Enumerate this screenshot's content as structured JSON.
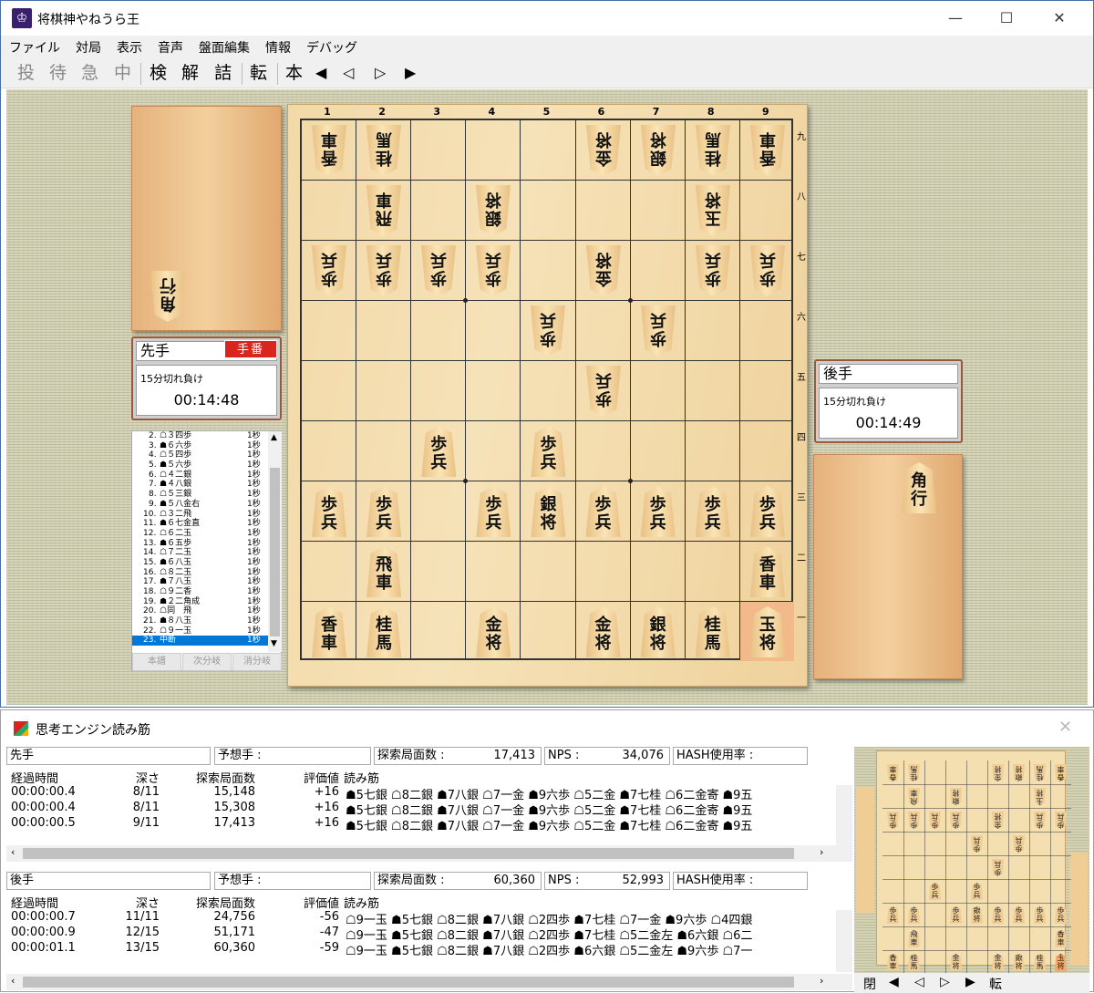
{
  "window": {
    "title": "将棋神やねうら王",
    "minimize": "—",
    "maximize": "☐",
    "close": "✕"
  },
  "menu": [
    "ファイル",
    "対局",
    "表示",
    "音声",
    "盤面編集",
    "情報",
    "デバッグ"
  ],
  "toolbar": {
    "b1": "投",
    "b2": "待",
    "b3": "急",
    "b4": "中",
    "b5": "検",
    "b6": "解",
    "b7": "詰",
    "b8": "転",
    "b9": "本",
    "b10": "◀",
    "b11": "◁",
    "b12": "▷",
    "b13": "▶"
  },
  "sente": {
    "name": "先手",
    "turn_badge": "手番",
    "rule": "15分切れ負け",
    "time": "00:14:48",
    "hand": [
      "角"
    ]
  },
  "gote": {
    "name": "後手",
    "rule": "15分切れ負け",
    "time": "00:14:49",
    "hand": [
      "角行"
    ]
  },
  "kifu": {
    "moves": [
      {
        "n": "2.",
        "m": "☖３四歩",
        "t": "1秒"
      },
      {
        "n": "3.",
        "m": "☗６六歩",
        "t": "1秒"
      },
      {
        "n": "4.",
        "m": "☖５四歩",
        "t": "1秒"
      },
      {
        "n": "5.",
        "m": "☗５六歩",
        "t": "1秒"
      },
      {
        "n": "6.",
        "m": "☖４二銀",
        "t": "1秒"
      },
      {
        "n": "7.",
        "m": "☗４八銀",
        "t": "1秒"
      },
      {
        "n": "8.",
        "m": "☖５三銀",
        "t": "1秒"
      },
      {
        "n": "9.",
        "m": "☗５八金右",
        "t": "1秒"
      },
      {
        "n": "10.",
        "m": "☖３二飛",
        "t": "1秒"
      },
      {
        "n": "11.",
        "m": "☗６七金直",
        "t": "1秒"
      },
      {
        "n": "12.",
        "m": "☖６二玉",
        "t": "1秒"
      },
      {
        "n": "13.",
        "m": "☗６五歩",
        "t": "1秒"
      },
      {
        "n": "14.",
        "m": "☖７二玉",
        "t": "1秒"
      },
      {
        "n": "15.",
        "m": "☗６八玉",
        "t": "1秒"
      },
      {
        "n": "16.",
        "m": "☖８二玉",
        "t": "1秒"
      },
      {
        "n": "17.",
        "m": "☗７八玉",
        "t": "1秒"
      },
      {
        "n": "18.",
        "m": "☖９二香",
        "t": "1秒"
      },
      {
        "n": "19.",
        "m": "☗２二角成",
        "t": "1秒"
      },
      {
        "n": "20.",
        "m": "☖同　飛",
        "t": "1秒"
      },
      {
        "n": "21.",
        "m": "☗８八玉",
        "t": "1秒"
      },
      {
        "n": "22.",
        "m": "☖９一玉",
        "t": "1秒"
      },
      {
        "n": "23.",
        "m": "中断",
        "t": "1秒"
      }
    ],
    "btn_main": "本譜",
    "btn_next": "次分岐",
    "btn_del": "消分岐"
  },
  "board": {
    "file_labels": [
      "1",
      "2",
      "3",
      "4",
      "5",
      "6",
      "7",
      "8",
      "9"
    ],
    "rank_labels": [
      "九",
      "八",
      "七",
      "六",
      "五",
      "四",
      "三",
      "二",
      "一"
    ],
    "pieces": [
      {
        "c": 0,
        "r": 0,
        "t": "香車",
        "g": true
      },
      {
        "c": 1,
        "r": 0,
        "t": "桂馬",
        "g": true
      },
      {
        "c": 5,
        "r": 0,
        "t": "金将",
        "g": true
      },
      {
        "c": 6,
        "r": 0,
        "t": "銀将",
        "g": true
      },
      {
        "c": 7,
        "r": 0,
        "t": "桂馬",
        "g": true
      },
      {
        "c": 8,
        "r": 0,
        "t": "香車",
        "g": true
      },
      {
        "c": 1,
        "r": 1,
        "t": "飛車",
        "g": true
      },
      {
        "c": 3,
        "r": 1,
        "t": "銀将",
        "g": true
      },
      {
        "c": 7,
        "r": 1,
        "t": "玉将",
        "g": true
      },
      {
        "c": 0,
        "r": 2,
        "t": "歩兵",
        "g": true
      },
      {
        "c": 1,
        "r": 2,
        "t": "歩兵",
        "g": true
      },
      {
        "c": 2,
        "r": 2,
        "t": "歩兵",
        "g": true
      },
      {
        "c": 3,
        "r": 2,
        "t": "歩兵",
        "g": true
      },
      {
        "c": 5,
        "r": 2,
        "t": "金将",
        "g": true
      },
      {
        "c": 7,
        "r": 2,
        "t": "歩兵",
        "g": true
      },
      {
        "c": 8,
        "r": 2,
        "t": "歩兵",
        "g": true
      },
      {
        "c": 4,
        "r": 3,
        "t": "歩兵",
        "g": true
      },
      {
        "c": 6,
        "r": 3,
        "t": "歩兵",
        "g": true
      },
      {
        "c": 5,
        "r": 4,
        "t": "歩兵",
        "g": true
      },
      {
        "c": 2,
        "r": 5,
        "t": "歩兵",
        "g": false
      },
      {
        "c": 4,
        "r": 5,
        "t": "歩兵",
        "g": false
      },
      {
        "c": 0,
        "r": 6,
        "t": "歩兵",
        "g": false
      },
      {
        "c": 1,
        "r": 6,
        "t": "歩兵",
        "g": false
      },
      {
        "c": 3,
        "r": 6,
        "t": "歩兵",
        "g": false
      },
      {
        "c": 4,
        "r": 6,
        "t": "銀将",
        "g": false
      },
      {
        "c": 5,
        "r": 6,
        "t": "歩兵",
        "g": false
      },
      {
        "c": 6,
        "r": 6,
        "t": "歩兵",
        "g": false
      },
      {
        "c": 7,
        "r": 6,
        "t": "歩兵",
        "g": false
      },
      {
        "c": 8,
        "r": 6,
        "t": "歩兵",
        "g": false
      },
      {
        "c": 1,
        "r": 7,
        "t": "飛車",
        "g": false
      },
      {
        "c": 8,
        "r": 7,
        "t": "香車",
        "g": false
      },
      {
        "c": 0,
        "r": 8,
        "t": "香車",
        "g": false
      },
      {
        "c": 1,
        "r": 8,
        "t": "桂馬",
        "g": false
      },
      {
        "c": 3,
        "r": 8,
        "t": "金将",
        "g": false
      },
      {
        "c": 5,
        "r": 8,
        "t": "金将",
        "g": false
      },
      {
        "c": 6,
        "r": 8,
        "t": "銀将",
        "g": false
      },
      {
        "c": 7,
        "r": 8,
        "t": "桂馬",
        "g": false
      },
      {
        "c": 8,
        "r": 8,
        "t": "玉将",
        "g": false
      }
    ],
    "last_move": {
      "c": 8,
      "r": 8
    }
  },
  "engine": {
    "title": "思考エンジン読み筋",
    "close": "✕",
    "hdr_labels": {
      "predict": "予想手 :",
      "nodes": "探索局面数 :",
      "nps": "NPS :",
      "hash": "HASH使用率 :"
    },
    "cols": [
      "経過時間",
      "深さ",
      "探索局面数",
      "評価値",
      "読み筋"
    ],
    "sente": {
      "name": "先手",
      "nodes": "17,413",
      "nps": "34,076",
      "rows": [
        {
          "time": "00:00:00.4",
          "depth": "8/11",
          "nodes": "15,148",
          "eval": "+16",
          "pv": "☗5七銀 ☖8二銀 ☗7八銀 ☖7一金 ☗9六歩 ☖5二金 ☗7七桂 ☖6二金寄 ☗9五"
        },
        {
          "time": "00:00:00.4",
          "depth": "8/11",
          "nodes": "15,308",
          "eval": "+16",
          "pv": "☗5七銀 ☖8二銀 ☗7八銀 ☖7一金 ☗9六歩 ☖5二金 ☗7七桂 ☖6二金寄 ☗9五"
        },
        {
          "time": "00:00:00.5",
          "depth": "9/11",
          "nodes": "17,413",
          "eval": "+16",
          "pv": "☗5七銀 ☖8二銀 ☗7八銀 ☖7一金 ☗9六歩 ☖5二金 ☗7七桂 ☖6二金寄 ☗9五"
        }
      ]
    },
    "gote": {
      "name": "後手",
      "nodes": "60,360",
      "nps": "52,993",
      "rows": [
        {
          "time": "00:00:00.7",
          "depth": "11/11",
          "nodes": "24,756",
          "eval": "-56",
          "pv": "☖9一玉 ☗5七銀 ☖8二銀 ☗7八銀 ☖2四歩 ☗7七桂 ☖7一金 ☗9六歩 ☖4四銀"
        },
        {
          "time": "00:00:00.9",
          "depth": "12/15",
          "nodes": "51,171",
          "eval": "-47",
          "pv": "☖9一玉 ☗5七銀 ☖8二銀 ☗7八銀 ☖2四歩 ☗7七桂 ☖5二金左 ☗6六銀 ☖6二"
        },
        {
          "time": "00:00:01.1",
          "depth": "13/15",
          "nodes": "60,360",
          "eval": "-59",
          "pv": "☖9一玉 ☗5七銀 ☖8二銀 ☗7八銀 ☖2四歩 ☗6六銀 ☖5二金左 ☗9六歩 ☖7一"
        }
      ]
    },
    "mini_nav": {
      "close": "閉",
      "first": "◀",
      "prev": "◁",
      "next": "▷",
      "last": "▶",
      "flip": "転"
    }
  }
}
